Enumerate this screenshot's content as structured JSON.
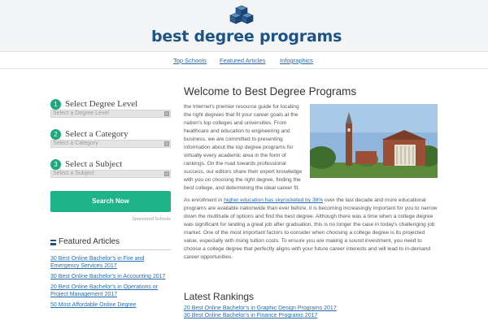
{
  "site": {
    "logo_text_1": "best ",
    "logo_text_2": "degree",
    "logo_text_3": " programs",
    "brand_color": "#1d5487",
    "accent_color": "#1fb38a"
  },
  "nav": {
    "items": [
      "Top Schools",
      "Featured Articles",
      "Infographics"
    ]
  },
  "finder": {
    "steps": [
      {
        "num": "1",
        "title": "Select Degree Level",
        "placeholder": "Select a Degree Level"
      },
      {
        "num": "2",
        "title": "Select a Category",
        "placeholder": "Select a Category"
      },
      {
        "num": "3",
        "title": "Select a Subject",
        "placeholder": "Select a Subject"
      }
    ],
    "search_label": "Search Now",
    "sponsored_label": "Sponsored Schools"
  },
  "featured": {
    "heading": "Featured Articles",
    "items": [
      "30 Best Online Bachelor's in Fire and Emergency Services 2017",
      "30 Best Online Bachelor's in Accounting 2017",
      "20 Best Online Bachelor's in Operations or Project Management 2017",
      "50 Most Affordable Online Degree"
    ]
  },
  "main": {
    "title": "Welcome to Best Degree Programs",
    "intro": "the Internet's premier resource guide for locating the right degrees that fit your career goals at the nation's top colleges and universities. From healthcare and education to engineering and business, we are committed to presenting information about the top degree programs for virtually every academic area in the form of rankings. On the road towards professional success, our editors share their expert knowledge with you on choosing the right degree, finding the best college, and determining the ideal career fit.",
    "para2_before": "As enrollment in ",
    "para2_link": "higher education has skyrocketed by 38%",
    "para2_after": " over the last decade and more educational programs are available nationwide than ever before, it is becoming increasingly important for you to narrow down the multitude of options and find the best degree. Although there was a time when a college degree was significant for landing a great job after graduation, this is no longer the case in today's challenging job market. One of the most important factors to consider when choosing a college degree is its projected value, especially with rising tuition costs. To ensure you are making a sound investment, you need to choose a college degree that perfectly aligns with your future career interests and will lead to in-demand career opportunities."
  },
  "latest": {
    "heading": "Latest Rankings",
    "items": [
      "20 Best Online Bachelor's in Graphic Design Programs 2017",
      "30 Best Online Bachelor's in Finance Programs 2017"
    ]
  }
}
